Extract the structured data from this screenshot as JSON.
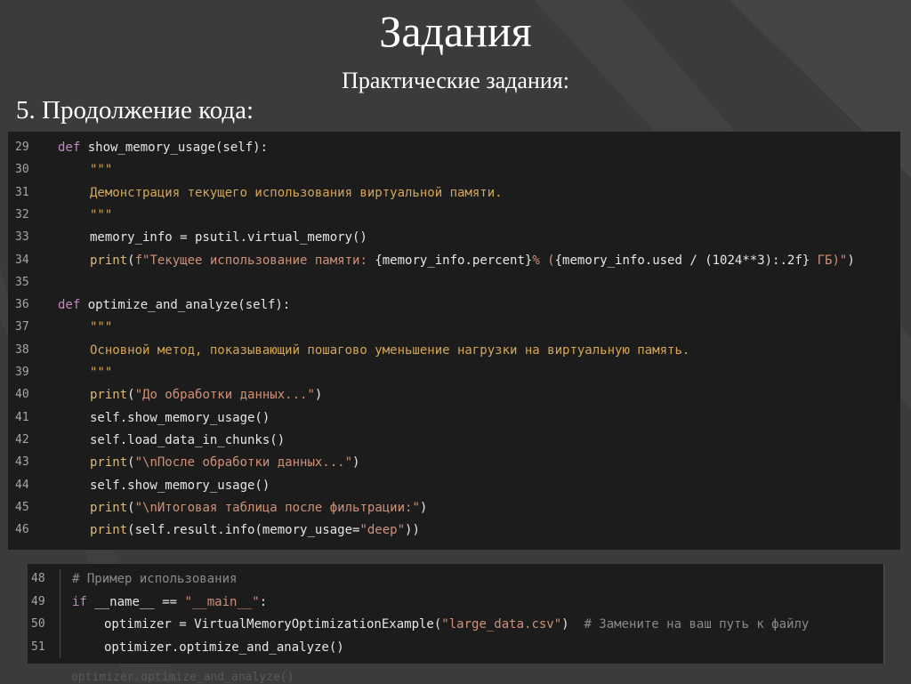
{
  "slide": {
    "title": "Задания",
    "subtitle": "Практические задания:",
    "section": "5. Продолжение кода:"
  },
  "code_main": [
    {
      "n": "29",
      "indent": 0,
      "tokens": [
        [
          "kw",
          "def "
        ],
        [
          "tx",
          "show_memory_usage(self):"
        ]
      ]
    },
    {
      "n": "30",
      "indent": 1,
      "tokens": [
        [
          "doc",
          "\"\"\""
        ]
      ]
    },
    {
      "n": "31",
      "indent": 1,
      "tokens": [
        [
          "doc",
          "Демонстрация текущего использования виртуальной памяти."
        ]
      ]
    },
    {
      "n": "32",
      "indent": 1,
      "tokens": [
        [
          "doc",
          "\"\"\""
        ]
      ]
    },
    {
      "n": "33",
      "indent": 1,
      "tokens": [
        [
          "tx",
          "memory_info = psutil.virtual_memory()"
        ]
      ]
    },
    {
      "n": "34",
      "indent": 1,
      "tokens": [
        [
          "kw2",
          "print"
        ],
        [
          "tx",
          "("
        ],
        [
          "str",
          "f\"Текущее использование памяти: "
        ],
        [
          "tx",
          "{memory_info.percent}"
        ],
        [
          "str",
          "% ("
        ],
        [
          "tx",
          "{memory_info.used / (1024**3):.2f}"
        ],
        [
          "str",
          " ГБ)\""
        ],
        [
          "tx",
          ")"
        ]
      ]
    },
    {
      "n": "35",
      "indent": 0,
      "tokens": []
    },
    {
      "n": "36",
      "indent": 0,
      "tokens": [
        [
          "kw",
          "def "
        ],
        [
          "tx",
          "optimize_and_analyze(self):"
        ]
      ]
    },
    {
      "n": "37",
      "indent": 1,
      "tokens": [
        [
          "doc",
          "\"\"\""
        ]
      ]
    },
    {
      "n": "38",
      "indent": 1,
      "tokens": [
        [
          "doc",
          "Основной метод, показывающий пошагово уменьшение нагрузки на виртуальную память."
        ]
      ]
    },
    {
      "n": "39",
      "indent": 1,
      "tokens": [
        [
          "doc",
          "\"\"\""
        ]
      ]
    },
    {
      "n": "40",
      "indent": 1,
      "tokens": [
        [
          "kw2",
          "print"
        ],
        [
          "tx",
          "("
        ],
        [
          "str",
          "\"До обработки данных...\""
        ],
        [
          "tx",
          ")"
        ]
      ]
    },
    {
      "n": "41",
      "indent": 1,
      "tokens": [
        [
          "tx",
          "self.show_memory_usage()"
        ]
      ]
    },
    {
      "n": "42",
      "indent": 1,
      "tokens": [
        [
          "tx",
          "self.load_data_in_chunks()"
        ]
      ]
    },
    {
      "n": "43",
      "indent": 1,
      "tokens": [
        [
          "kw2",
          "print"
        ],
        [
          "tx",
          "("
        ],
        [
          "str",
          "\"\\nПосле обработки данных...\""
        ],
        [
          "tx",
          ")"
        ]
      ]
    },
    {
      "n": "44",
      "indent": 1,
      "tokens": [
        [
          "tx",
          "self.show_memory_usage()"
        ]
      ]
    },
    {
      "n": "45",
      "indent": 1,
      "tokens": [
        [
          "kw2",
          "print"
        ],
        [
          "tx",
          "("
        ],
        [
          "str",
          "\"\\nИтоговая таблица после фильтрации:\""
        ],
        [
          "tx",
          ")"
        ]
      ]
    },
    {
      "n": "46",
      "indent": 1,
      "tokens": [
        [
          "kw2",
          "print"
        ],
        [
          "tx",
          "(self.result.info(memory_usage="
        ],
        [
          "str",
          "\"deep\""
        ],
        [
          "tx",
          "))"
        ]
      ]
    }
  ],
  "code_example": [
    {
      "n": "48",
      "indent": 0,
      "tokens": [
        [
          "com",
          "# Пример использования"
        ]
      ]
    },
    {
      "n": "49",
      "indent": 0,
      "tokens": [
        [
          "kw",
          "if "
        ],
        [
          "tx",
          "__name__ == "
        ],
        [
          "str",
          "\"__main__\""
        ],
        [
          "tx",
          ":"
        ]
      ]
    },
    {
      "n": "50",
      "indent": 1,
      "tokens": [
        [
          "tx",
          "optimizer = VirtualMemoryOptimizationExample("
        ],
        [
          "str",
          "\"large_data.csv\""
        ],
        [
          "tx",
          ")  "
        ],
        [
          "com",
          "# Замените на ваш путь к файлу"
        ]
      ]
    },
    {
      "n": "51",
      "indent": 1,
      "tokens": [
        [
          "tx",
          "optimizer.optimize_and_analyze()"
        ]
      ]
    }
  ],
  "colors": {
    "background": "#3b3b3b",
    "code_background": "#1c1c1c",
    "keyword": "#c586c0",
    "string": "#ce9178",
    "docstring": "#d4a656",
    "comment": "#8a8a8a"
  }
}
